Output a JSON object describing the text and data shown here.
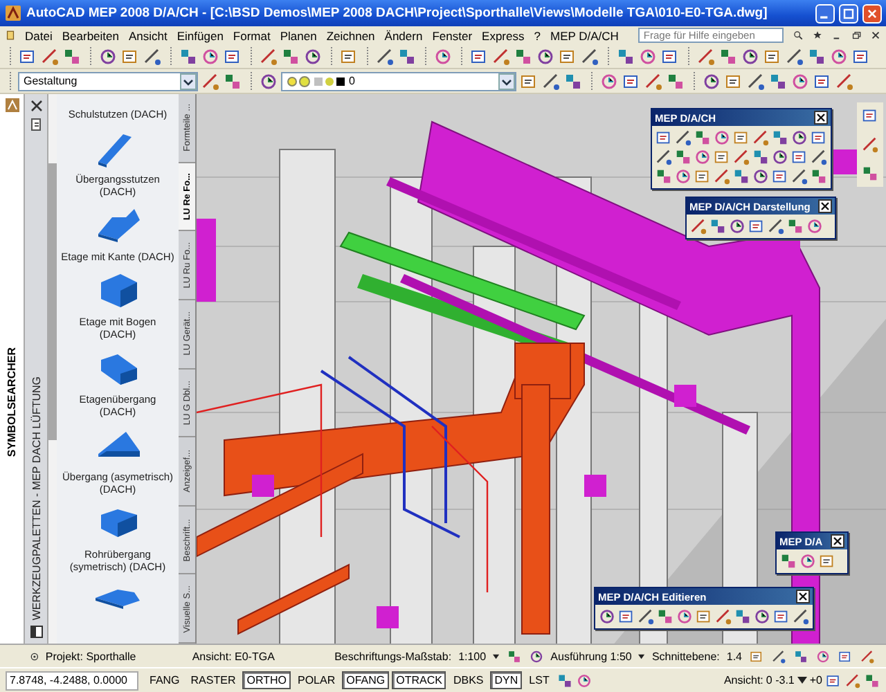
{
  "window": {
    "title": "AutoCAD MEP 2008 D/A/CH - [C:\\BSD Demos\\MEP 2008 DACH\\Project\\Sporthalle\\Views\\Modelle TGA\\010-E0-TGA.dwg]"
  },
  "menu": [
    "Datei",
    "Bearbeiten",
    "Ansicht",
    "Einfügen",
    "Format",
    "Planen",
    "Zeichnen",
    "Ändern",
    "Fenster",
    "Express",
    "?",
    "MEP D/A/CH"
  ],
  "help_search": {
    "placeholder": "Frage für Hilfe eingeben"
  },
  "style_dropdown": {
    "value": "Gestaltung"
  },
  "layer_dropdown": {
    "value": "0"
  },
  "side_strip": {
    "title": "SYMBOLSEARCHER"
  },
  "tool_palette": {
    "title": "WERKZEUGPALETTEN - MEP DACH LÜFTUNG",
    "items": [
      {
        "label": "Schulstutzen (DACH)"
      },
      {
        "label": "Übergangsstutzen (DACH)"
      },
      {
        "label": "Etage mit Kante (DACH)"
      },
      {
        "label": "Etage mit Bogen (DACH)"
      },
      {
        "label": "Etagenübergang (DACH)"
      },
      {
        "label": "Übergang (asymetrisch) (DACH)"
      },
      {
        "label": "Rohrübergang (symetrisch) (DACH)"
      }
    ],
    "tabs": [
      {
        "label": "Formteile ...",
        "selected": false
      },
      {
        "label": "LU Re Fo...",
        "selected": true
      },
      {
        "label": "LU Ru Fo...",
        "selected": false
      },
      {
        "label": "LU Gerät...",
        "selected": false
      },
      {
        "label": "LU G Dbl...",
        "selected": false
      },
      {
        "label": "Anzeigef...",
        "selected": false
      },
      {
        "label": "Beschrift...",
        "selected": false
      },
      {
        "label": "Visuelle S...",
        "selected": false
      }
    ]
  },
  "floating_toolbars": [
    {
      "title": "MEP D/A/CH"
    },
    {
      "title": "MEP D/A/CH Darstellung"
    },
    {
      "title": "MEP D/A"
    },
    {
      "title": "MEP D/A/CH Editieren"
    }
  ],
  "drawing_status": {
    "project": "Projekt: Sporthalle",
    "view": "Ansicht: E0-TGA",
    "scale_label": "Beschriftungs-Maßstab:",
    "scale": "1:100",
    "detail": "Ausführung 1:50",
    "cut_plane_label": "Schnittebene:",
    "cut_plane": "1.4"
  },
  "status_bar": {
    "coordinates": "7.8748, -4.2488, 0.0000",
    "toggles": [
      {
        "label": "FANG",
        "on": false
      },
      {
        "label": "RASTER",
        "on": false
      },
      {
        "label": "ORTHO",
        "on": true
      },
      {
        "label": "POLAR",
        "on": false
      },
      {
        "label": "OFANG",
        "on": true
      },
      {
        "label": "OTRACK",
        "on": true
      },
      {
        "label": "DBKS",
        "on": false
      },
      {
        "label": "DYN",
        "on": true
      },
      {
        "label": "LST",
        "on": false
      }
    ],
    "view_label": "Ansicht:",
    "elevation": "0 -3.1",
    "offset": "+0"
  }
}
